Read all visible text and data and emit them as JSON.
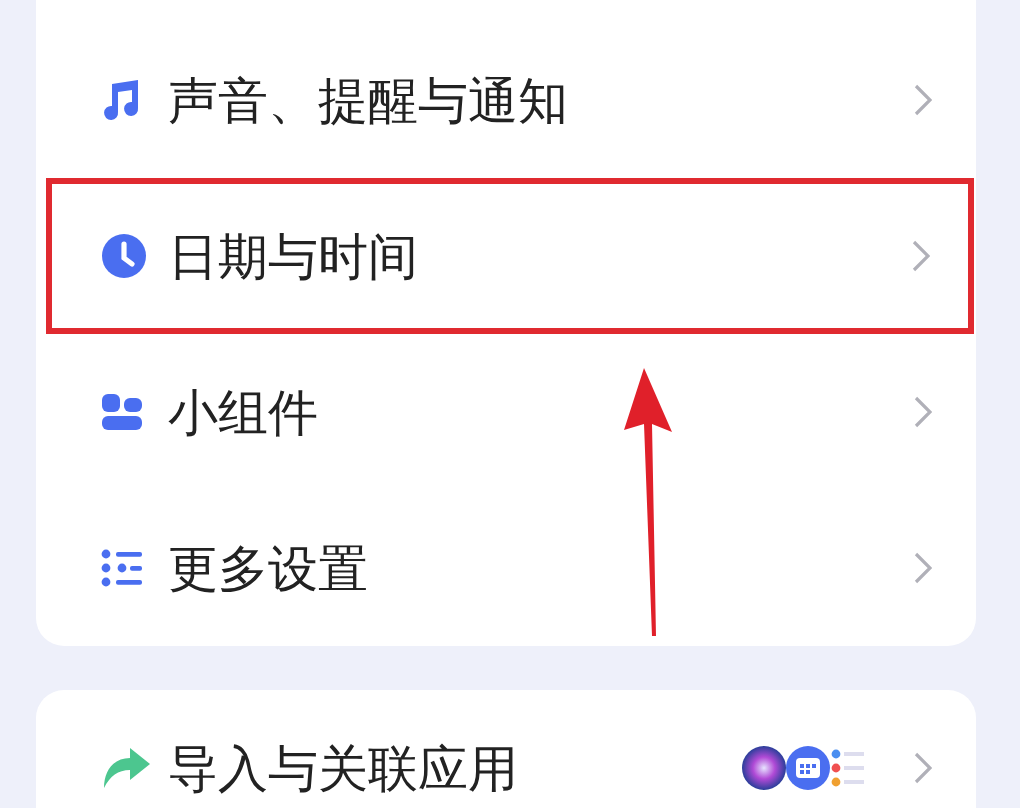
{
  "sections": [
    {
      "items": [
        {
          "label": "声音、提醒与通知",
          "kind": "plain",
          "highlighted": false
        },
        {
          "label": "日期与时间",
          "kind": "plain",
          "highlighted": true
        },
        {
          "label": "小组件",
          "kind": "plain",
          "highlighted": false
        },
        {
          "label": "更多设置",
          "kind": "plain",
          "highlighted": false
        }
      ]
    },
    {
      "items": [
        {
          "label": "导入与关联应用",
          "kind": "apps",
          "highlighted": false
        }
      ]
    }
  ]
}
